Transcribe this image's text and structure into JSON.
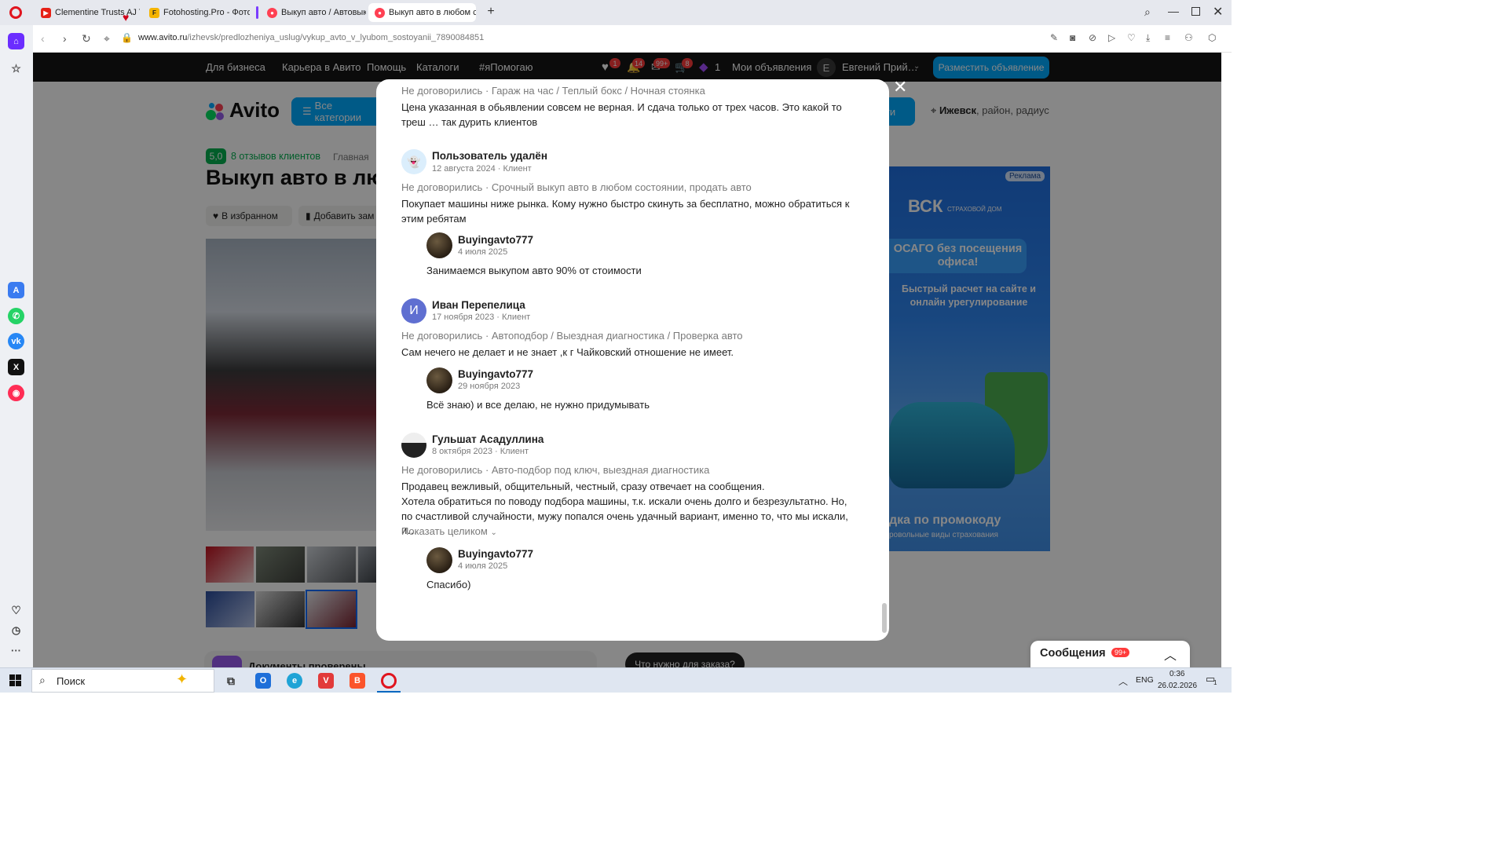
{
  "browser": {
    "tabs": [
      {
        "title": "Clementine Trusts AJ To M",
        "icon": "youtube-icon"
      },
      {
        "title": "Fotohosting.Pro - Фотохо",
        "icon": "fotohosting-icon"
      },
      {
        "title": "Выкуп авто / Автовыкуп",
        "icon": "avito-icon"
      },
      {
        "title": "Выкуп авто в любом сос",
        "icon": "avito-icon"
      }
    ],
    "url_host": "www.avito.ru",
    "url_path": "/izhevsk/predlozheniya_uslug/vykup_avto_v_lyubom_sostoyanii_7890084851"
  },
  "avito_nav": {
    "links": [
      "Для бизнеса",
      "Карьера в Авито",
      "Помощь",
      "Каталоги",
      "#яПомогаю"
    ],
    "badges": [
      "1",
      "14",
      "99+",
      "8"
    ],
    "bonus_count": "1",
    "my_ads": "Мои объявления",
    "user_initial": "Е",
    "user_name": "Евгений Прий…",
    "post_button": "Разместить объявление"
  },
  "background_page": {
    "logo": "Avito",
    "categories_button": "Все категории",
    "search_button": "ти",
    "location_city": "Ижевск",
    "location_rest": ", район, радиус",
    "rating": "5,0",
    "reviews_link": "8 отзывов клиентов",
    "breadcrumb": "Главная",
    "title": "Выкуп авто в люб",
    "favorite_button": "В избранном",
    "note_button": "Добавить зам",
    "ad_label": "Реклама",
    "ad_brand": "ВСК",
    "ad_brand_sub": "СТРАХОВОЙ ДОМ",
    "ad_headline": "ОСАГО без посещения офиса!",
    "ad_text": "Быстрый расчет на сайте и онлайн урегулирование",
    "ad_footer": "дка по промокоду",
    "ad_footer_small": "ровольные виды страхования",
    "bottom_section": "Документы проверены",
    "bottom_button": "Что нужно для заказа?"
  },
  "modal": {
    "top_review": {
      "tags": "Не договорились · Гараж на час / Теплый бокс / Ночная стоянка",
      "text": "Цена указанная в обьявлении совсем не верная. И сдача только от трех часов. Это какой то треш … так дурить клиентов"
    },
    "reviews": [
      {
        "author": "Пользователь удалён",
        "date": "12 августа 2024 · Клиент",
        "tags": "Не договорились · Срочный выкуп авто в любом состоянии, продать авто",
        "text": "Покупает машины ниже рынка. Кому нужно быстро скинуть за бесплатно, можно обратиться к этим ребятам",
        "reply": {
          "author": "Buyingavto777",
          "date": "4 июля 2025",
          "text": "Занимаемся выкупом авто 90% от стоимости"
        }
      },
      {
        "author": "Иван Перепелица",
        "avatar_letter": "И",
        "date": "17 ноября 2023 · Клиент",
        "tags": "Не договорились · Автоподбор / Выездная диагностика / Проверка авто",
        "text": "Сам нечего не делает и не знает ,к г Чайковский отношение не имеет.",
        "reply": {
          "author": "Buyingavto777",
          "date": "29 ноября 2023",
          "text": "Всё знаю) и все делаю, не нужно придумывать"
        }
      },
      {
        "author": "Гульшат Асадуллина",
        "date": "8 октября 2023 · Клиент",
        "tags": "Не договорились · Авто-подбор под ключ, выездная диагностика",
        "text_line1": "Продавец вежливый, общительный, честный, сразу отвечает на сообщения.",
        "text_line2": "Хотела обратиться по поводу подбора машины, т.к. искали очень долго и безрезультатно. Но, по счастливой случайности, мужу попался очень удачный вариант, именно то, что мы искали, и…",
        "show_more": "Показать целиком",
        "reply": {
          "author": "Buyingavto777",
          "date": "4 июля 2025",
          "text": "Спасибо)"
        }
      }
    ]
  },
  "messages_widget": {
    "label": "Сообщения",
    "badge": "99+"
  },
  "taskbar": {
    "search_placeholder": "Поиск",
    "lang": "ENG",
    "time": "0:36",
    "date": "26.02.2026",
    "notif_count": "1"
  }
}
